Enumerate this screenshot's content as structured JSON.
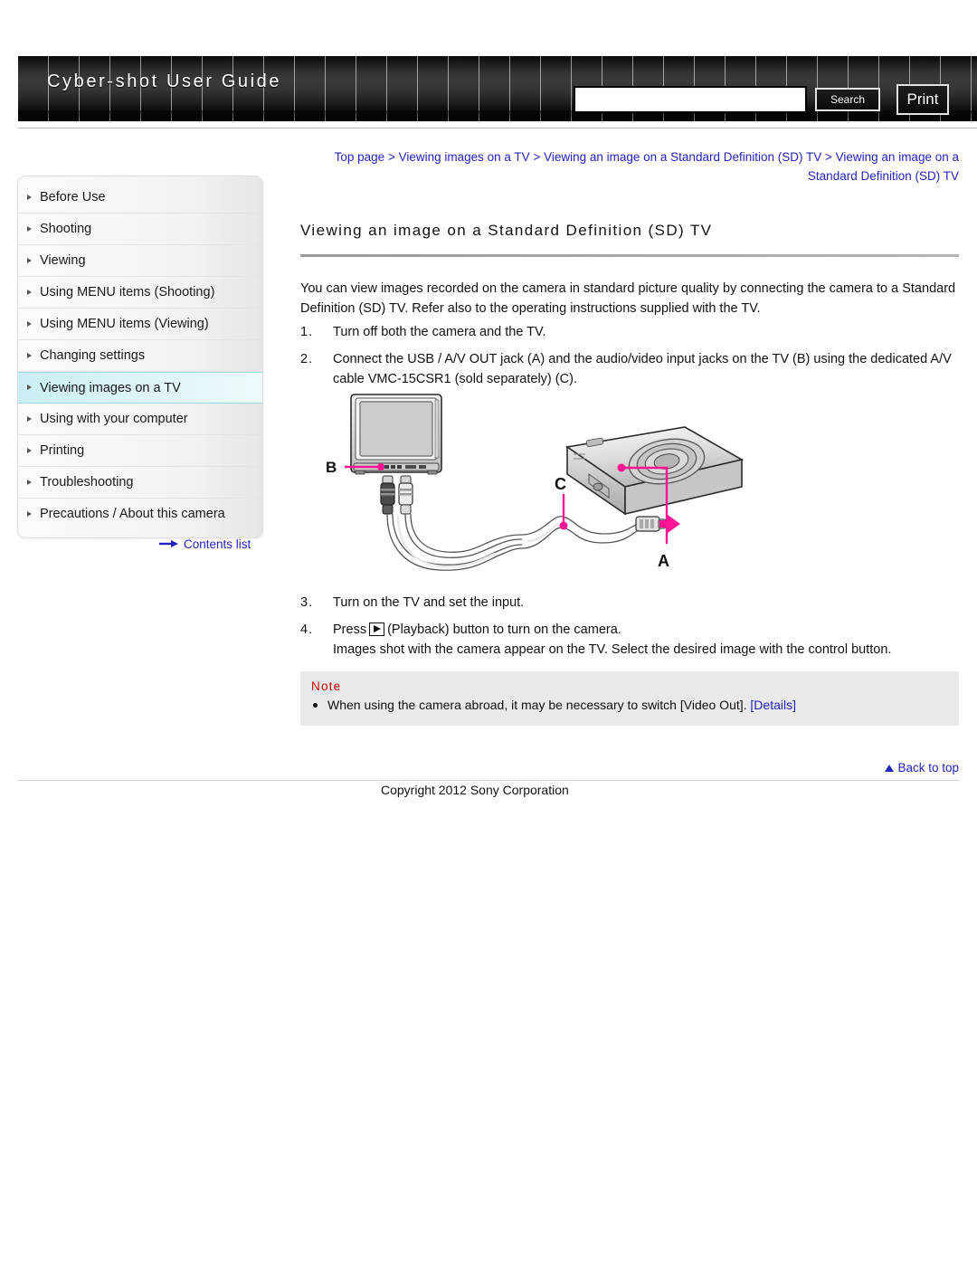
{
  "header": {
    "brand_title": "Cyber-shot User Guide",
    "search_value": "",
    "search_placeholder": "",
    "search_label": "Search",
    "print_label": "Print"
  },
  "breadcrumb": {
    "items": [
      "Top page",
      "Viewing images on a TV",
      "Viewing an image on a Standard Definition (SD) TV",
      "Viewing an image on a Standard Definition (SD) TV"
    ],
    "separator": " > "
  },
  "sidebar": {
    "items": [
      {
        "label": "Before Use",
        "active": false
      },
      {
        "label": "Shooting",
        "active": false
      },
      {
        "label": "Viewing",
        "active": false
      },
      {
        "label": "Using MENU items (Shooting)",
        "active": false
      },
      {
        "label": "Using MENU items (Viewing)",
        "active": false
      },
      {
        "label": "Changing settings",
        "active": false
      },
      {
        "label": "Viewing images on a TV",
        "active": true
      },
      {
        "label": "Using with your computer",
        "active": false
      },
      {
        "label": "Printing",
        "active": false
      },
      {
        "label": "Troubleshooting",
        "active": false
      },
      {
        "label": "Precautions / About this camera",
        "active": false
      }
    ],
    "contents_list_label": "Contents list"
  },
  "main": {
    "title": "Viewing an image on a Standard Definition (SD) TV",
    "intro": "You can view images recorded on the camera in standard picture quality by connecting the camera to a Standard Definition (SD) TV. Refer also to the operating instructions supplied with the TV.",
    "steps_before": [
      {
        "num": "1.",
        "text": "Turn off both the camera and the TV."
      },
      {
        "num": "2.",
        "text": "Connect the USB / A/V OUT jack (A) and the audio/video input jacks on the TV (B) using the dedicated A/V cable VMC-15CSR1 (sold separately) (C)."
      }
    ],
    "steps_after": [
      {
        "num": "3.",
        "text": "Turn on the TV and set the input."
      }
    ],
    "step4": {
      "num": "4.",
      "text_before": "Press",
      "icon": "playback-icon",
      "text_after": "(Playback) button to turn on the camera.",
      "subtext": "Images shot with the camera appear on the TV. Select the desired image with the control button."
    },
    "diagram": {
      "label_a": "A",
      "label_b": "B",
      "label_c": "C",
      "callout_color": "#ff1493"
    }
  },
  "note": {
    "heading": "Note",
    "text": "When using the camera abroad, it may be necessary to switch [Video Out].",
    "link_label": "[Details]"
  },
  "footer": {
    "back_to_top": "Back to top",
    "copyright": "Copyright 2012 Sony Corporation"
  },
  "colors": {
    "link": "#2323c4",
    "note_heading": "#cc0000",
    "active_nav": "#c9eef3",
    "callout_pink": "#ff1493"
  }
}
